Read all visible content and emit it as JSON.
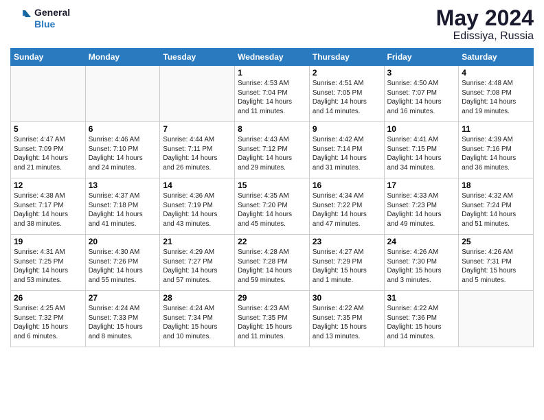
{
  "logo": {
    "text_general": "General",
    "text_blue": "Blue"
  },
  "title": {
    "month_year": "May 2024",
    "location": "Edissiya, Russia"
  },
  "days_of_week": [
    "Sunday",
    "Monday",
    "Tuesday",
    "Wednesday",
    "Thursday",
    "Friday",
    "Saturday"
  ],
  "weeks": [
    [
      {
        "day": "",
        "info": ""
      },
      {
        "day": "",
        "info": ""
      },
      {
        "day": "",
        "info": ""
      },
      {
        "day": "1",
        "info": "Sunrise: 4:53 AM\nSunset: 7:04 PM\nDaylight: 14 hours\nand 11 minutes."
      },
      {
        "day": "2",
        "info": "Sunrise: 4:51 AM\nSunset: 7:05 PM\nDaylight: 14 hours\nand 14 minutes."
      },
      {
        "day": "3",
        "info": "Sunrise: 4:50 AM\nSunset: 7:07 PM\nDaylight: 14 hours\nand 16 minutes."
      },
      {
        "day": "4",
        "info": "Sunrise: 4:48 AM\nSunset: 7:08 PM\nDaylight: 14 hours\nand 19 minutes."
      }
    ],
    [
      {
        "day": "5",
        "info": "Sunrise: 4:47 AM\nSunset: 7:09 PM\nDaylight: 14 hours\nand 21 minutes."
      },
      {
        "day": "6",
        "info": "Sunrise: 4:46 AM\nSunset: 7:10 PM\nDaylight: 14 hours\nand 24 minutes."
      },
      {
        "day": "7",
        "info": "Sunrise: 4:44 AM\nSunset: 7:11 PM\nDaylight: 14 hours\nand 26 minutes."
      },
      {
        "day": "8",
        "info": "Sunrise: 4:43 AM\nSunset: 7:12 PM\nDaylight: 14 hours\nand 29 minutes."
      },
      {
        "day": "9",
        "info": "Sunrise: 4:42 AM\nSunset: 7:14 PM\nDaylight: 14 hours\nand 31 minutes."
      },
      {
        "day": "10",
        "info": "Sunrise: 4:41 AM\nSunset: 7:15 PM\nDaylight: 14 hours\nand 34 minutes."
      },
      {
        "day": "11",
        "info": "Sunrise: 4:39 AM\nSunset: 7:16 PM\nDaylight: 14 hours\nand 36 minutes."
      }
    ],
    [
      {
        "day": "12",
        "info": "Sunrise: 4:38 AM\nSunset: 7:17 PM\nDaylight: 14 hours\nand 38 minutes."
      },
      {
        "day": "13",
        "info": "Sunrise: 4:37 AM\nSunset: 7:18 PM\nDaylight: 14 hours\nand 41 minutes."
      },
      {
        "day": "14",
        "info": "Sunrise: 4:36 AM\nSunset: 7:19 PM\nDaylight: 14 hours\nand 43 minutes."
      },
      {
        "day": "15",
        "info": "Sunrise: 4:35 AM\nSunset: 7:20 PM\nDaylight: 14 hours\nand 45 minutes."
      },
      {
        "day": "16",
        "info": "Sunrise: 4:34 AM\nSunset: 7:22 PM\nDaylight: 14 hours\nand 47 minutes."
      },
      {
        "day": "17",
        "info": "Sunrise: 4:33 AM\nSunset: 7:23 PM\nDaylight: 14 hours\nand 49 minutes."
      },
      {
        "day": "18",
        "info": "Sunrise: 4:32 AM\nSunset: 7:24 PM\nDaylight: 14 hours\nand 51 minutes."
      }
    ],
    [
      {
        "day": "19",
        "info": "Sunrise: 4:31 AM\nSunset: 7:25 PM\nDaylight: 14 hours\nand 53 minutes."
      },
      {
        "day": "20",
        "info": "Sunrise: 4:30 AM\nSunset: 7:26 PM\nDaylight: 14 hours\nand 55 minutes."
      },
      {
        "day": "21",
        "info": "Sunrise: 4:29 AM\nSunset: 7:27 PM\nDaylight: 14 hours\nand 57 minutes."
      },
      {
        "day": "22",
        "info": "Sunrise: 4:28 AM\nSunset: 7:28 PM\nDaylight: 14 hours\nand 59 minutes."
      },
      {
        "day": "23",
        "info": "Sunrise: 4:27 AM\nSunset: 7:29 PM\nDaylight: 15 hours\nand 1 minute."
      },
      {
        "day": "24",
        "info": "Sunrise: 4:26 AM\nSunset: 7:30 PM\nDaylight: 15 hours\nand 3 minutes."
      },
      {
        "day": "25",
        "info": "Sunrise: 4:26 AM\nSunset: 7:31 PM\nDaylight: 15 hours\nand 5 minutes."
      }
    ],
    [
      {
        "day": "26",
        "info": "Sunrise: 4:25 AM\nSunset: 7:32 PM\nDaylight: 15 hours\nand 6 minutes."
      },
      {
        "day": "27",
        "info": "Sunrise: 4:24 AM\nSunset: 7:33 PM\nDaylight: 15 hours\nand 8 minutes."
      },
      {
        "day": "28",
        "info": "Sunrise: 4:24 AM\nSunset: 7:34 PM\nDaylight: 15 hours\nand 10 minutes."
      },
      {
        "day": "29",
        "info": "Sunrise: 4:23 AM\nSunset: 7:35 PM\nDaylight: 15 hours\nand 11 minutes."
      },
      {
        "day": "30",
        "info": "Sunrise: 4:22 AM\nSunset: 7:35 PM\nDaylight: 15 hours\nand 13 minutes."
      },
      {
        "day": "31",
        "info": "Sunrise: 4:22 AM\nSunset: 7:36 PM\nDaylight: 15 hours\nand 14 minutes."
      },
      {
        "day": "",
        "info": ""
      }
    ]
  ]
}
